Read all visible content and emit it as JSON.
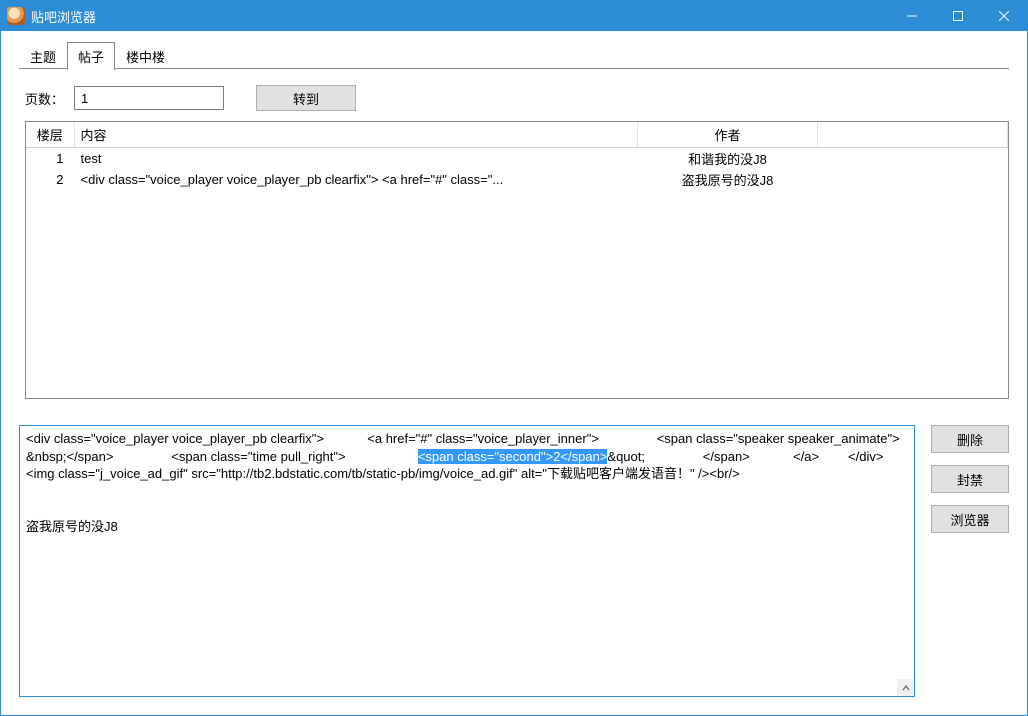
{
  "window": {
    "title": "贴吧浏览器"
  },
  "tabs": {
    "items": [
      {
        "label": "主题",
        "active": false
      },
      {
        "label": "帖子",
        "active": true
      },
      {
        "label": "楼中楼",
        "active": false
      }
    ]
  },
  "page_row": {
    "label": "页数：",
    "value": "1",
    "go_label": "转到"
  },
  "grid": {
    "headers": {
      "floor": "楼层",
      "content": "内容",
      "author": "作者"
    },
    "rows": [
      {
        "floor": "1",
        "content": "test",
        "author": "和谐我的没J8"
      },
      {
        "floor": "2",
        "content": "<div class=\"voice_player voice_player_pb clearfix\">            <a href=\"#\" class=\"...",
        "author": "盗我原号的没J8"
      }
    ]
  },
  "detail": {
    "seg1": "<div class=\"voice_player voice_player_pb clearfix\">            <a href=\"#\" class=\"voice_player_inner\">                <span class=\"speaker speaker_animate\">&nbsp;</span>                <span class=\"time pull_right\">                    ",
    "highlight": "<span class=\"second\">2</span>",
    "seg2": "&quot;                </span>            </a>        </div>        <img class=\"j_voice_ad_gif\" src=\"http://tb2.bdstatic.com/tb/static-pb/img/voice_ad.gif\" alt=\"下载贴吧客户端发语音！\" /><br/>",
    "author_line": "盗我原号的没J8"
  },
  "side": {
    "delete": "删除",
    "ban": "封禁",
    "browser": "浏览器"
  }
}
